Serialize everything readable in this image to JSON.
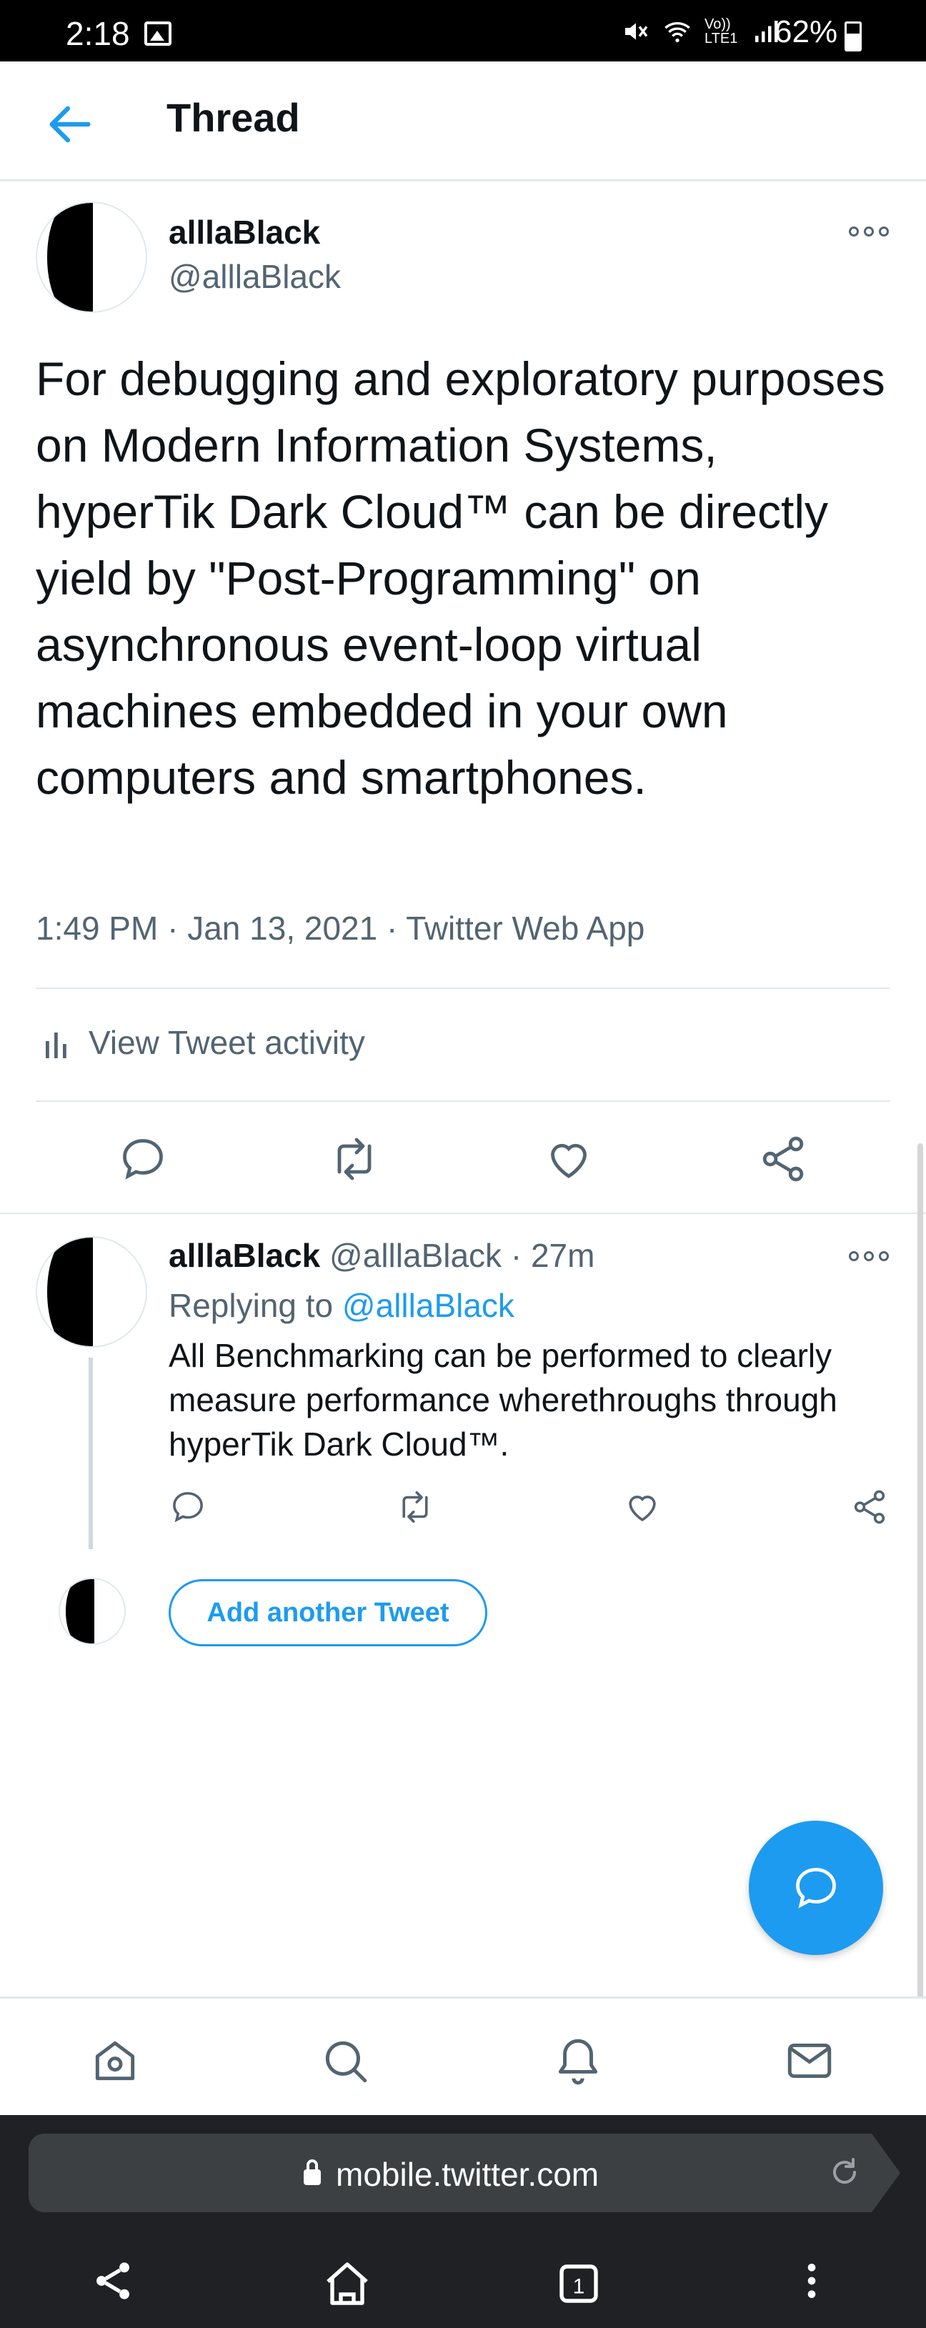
{
  "status_bar": {
    "time": "2:18",
    "network": "Vo)) LTE1",
    "battery": "62%"
  },
  "header": {
    "title": "Thread"
  },
  "main_tweet": {
    "name": "alllaBlack",
    "handle": "@alllaBlack",
    "text": "For debugging and exploratory purposes on Modern Information Systems, hyperTik Dark Cloud™ can be directly yield by \"Post-Programming\" on asynchronous event-loop virtual machines embedded in your own computers and smartphones.",
    "time": "1:49 PM",
    "date": "Jan 13, 2021",
    "source": "Twitter Web App",
    "activity_label": "View Tweet activity"
  },
  "reply_tweet": {
    "name": "alllaBlack",
    "handle": "@alllaBlack",
    "age": "27m",
    "replying_prefix": "Replying to",
    "replying_to": "@alllaBlack",
    "text": "All Benchmarking can be performed to clearly measure performance wherethroughs through hyperTik Dark Cloud™."
  },
  "compose": {
    "add_label": "Add another Tweet"
  },
  "browser": {
    "url": "mobile.twitter.com",
    "tab_count": "1"
  },
  "colors": {
    "accent": "#1d9bf0",
    "secondary_text": "#536471",
    "divider": "#e1e8ed"
  }
}
